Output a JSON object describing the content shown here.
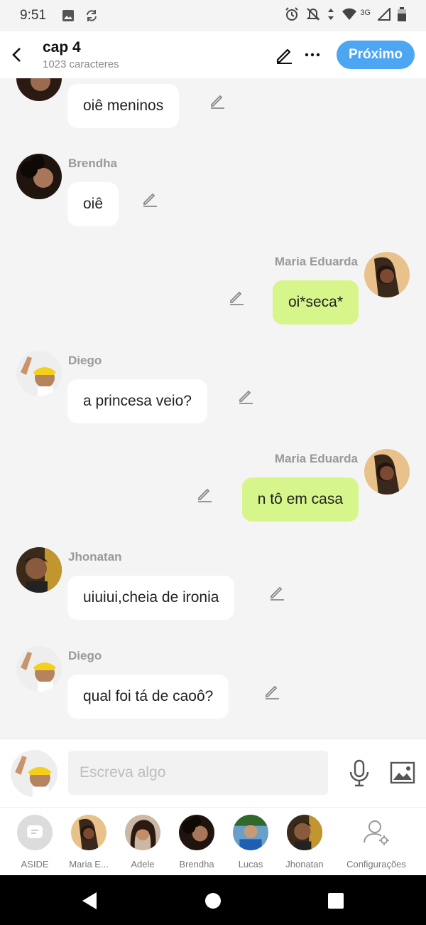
{
  "status_bar": {
    "time": "9:51",
    "network": "3G"
  },
  "header": {
    "title": "cap 4",
    "subtitle": "1023 caracteres",
    "next_label": "Próximo"
  },
  "messages": [
    {
      "sender": "",
      "text": "oiê meninos"
    },
    {
      "sender": "Brendha",
      "text": "oiê"
    },
    {
      "sender": "Maria Eduarda",
      "text": "oi*seca*"
    },
    {
      "sender": "Diego",
      "text": "a princesa veio?"
    },
    {
      "sender": "Maria Eduarda",
      "text": "n tô em casa"
    },
    {
      "sender": "Jhonatan",
      "text": "uiuiui,cheia de ironia"
    },
    {
      "sender": "Diego",
      "text": "qual foi tá de caoô?"
    }
  ],
  "composer": {
    "placeholder": "Escreva algo"
  },
  "characters": [
    {
      "label": "ASIDE"
    },
    {
      "label": "Maria E..."
    },
    {
      "label": "Adele"
    },
    {
      "label": "Brendha"
    },
    {
      "label": "Lucas"
    },
    {
      "label": "Jhonatan"
    },
    {
      "label": "Configurações"
    }
  ],
  "colors": {
    "accent": "#4da6f2",
    "outgoing_bubble": "#d6f58a",
    "incoming_bubble": "#ffffff",
    "background": "#f4f4f4"
  },
  "icons": [
    "back-arrow-icon",
    "pencil-icon",
    "more-icon",
    "edit-icon",
    "mic-icon",
    "image-icon",
    "aside-icon",
    "settings-user-icon"
  ]
}
